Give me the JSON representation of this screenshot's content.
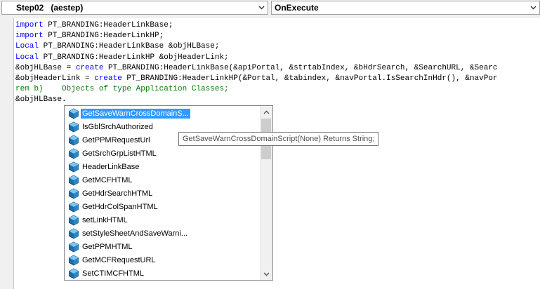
{
  "toolbar": {
    "left_combo": "Step02   (aestep)",
    "right_combo": "OnExecute"
  },
  "editor": {
    "lines": [
      [
        {
          "t": "import",
          "c": "kw"
        },
        {
          "t": " PT_BRANDING:HeaderLinkBase;",
          "c": ""
        }
      ],
      [
        {
          "t": "import",
          "c": "kw"
        },
        {
          "t": " PT_BRANDING:HeaderLinkHP;",
          "c": ""
        }
      ],
      [
        {
          "t": "Local",
          "c": "kw"
        },
        {
          "t": " PT_BRANDING:HeaderLinkBase &objHLBase;",
          "c": ""
        }
      ],
      [
        {
          "t": "Local",
          "c": "kw"
        },
        {
          "t": " PT_BRANDING:HeaderLinkHP &objHeaderLink;",
          "c": ""
        }
      ],
      [
        {
          "t": "&objHLBase = ",
          "c": ""
        },
        {
          "t": "create",
          "c": "kw"
        },
        {
          "t": " PT_BRANDING:HeaderLinkBase(&apiPortal, &strtabIndex, &bHdrSearch, &SearchURL, &Searc",
          "c": ""
        }
      ],
      [
        {
          "t": "&objHeaderLink = ",
          "c": ""
        },
        {
          "t": "create",
          "c": "kw"
        },
        {
          "t": " PT_BRANDING:HeaderLinkHP(&Portal, &tabindex, &navPortal.IsSearchInHdr(), &navPor",
          "c": ""
        }
      ],
      [
        {
          "t": "rem b)    Objects of type Application Classes;",
          "c": "cm"
        }
      ],
      [
        {
          "t": "&objHLBase.",
          "c": ""
        }
      ]
    ]
  },
  "autocomplete": {
    "items": [
      "GetSaveWarnCrossDomainS...",
      "IsGblSrchAuthorized",
      "GetPPMRequestUrl",
      "GetSrchGrpListHTML",
      "HeaderLinkBase",
      "GetMCFHTML",
      "GetHdrSearchHTML",
      "GetHdrColSpanHTML",
      "setLinkHTML",
      "setStyleSheetAndSaveWarni...",
      "GetPPMHTML",
      "GetMCFRequestURL",
      "SetCTIMCFHTML"
    ],
    "selected_index": 0,
    "icon": "method-cube-icon"
  },
  "tooltip": {
    "text": "GetSaveWarnCrossDomainScript(None) Returns String;"
  }
}
